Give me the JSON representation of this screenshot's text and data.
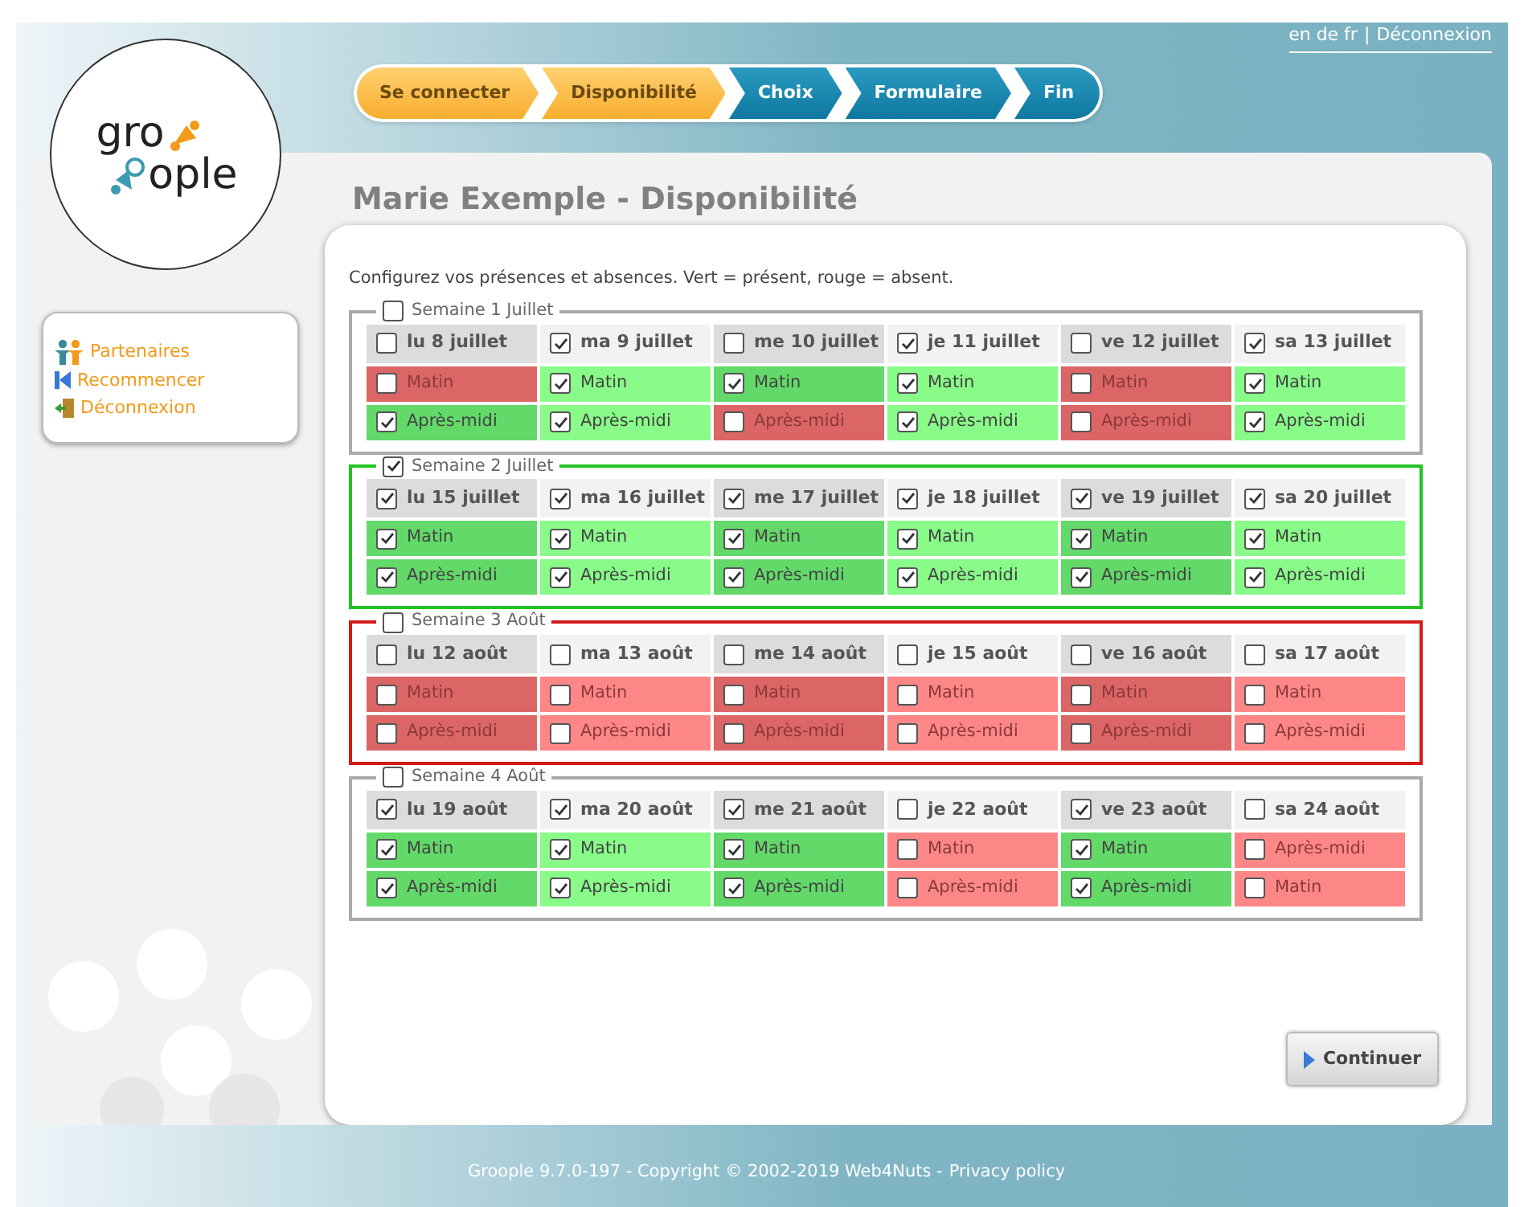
{
  "top_links": {
    "languages": "en de fr",
    "separator": "|",
    "logout": "Déconnexion"
  },
  "logo": {
    "part_1": "gro",
    "part_2": "ople"
  },
  "steps": [
    {
      "label": "Se connecter",
      "done": true
    },
    {
      "label": "Disponibilité",
      "done": true
    },
    {
      "label": "Choix",
      "done": false
    },
    {
      "label": "Formulaire",
      "done": false
    },
    {
      "label": "Fin",
      "done": false
    }
  ],
  "sidebar": {
    "items": [
      {
        "label": "Partenaires",
        "kind": "partners"
      },
      {
        "label": "Recommencer",
        "kind": "restart"
      },
      {
        "label": "Déconnexion",
        "kind": "logout"
      }
    ]
  },
  "title": "Marie Exemple - Disponibilité",
  "intro": "Configurez vos présences et absences. Vert = présent, rouge = absent.",
  "weeks": [
    {
      "label": "Semaine 1 Juillet",
      "checked": false,
      "color": "#aaaaaa",
      "days": [
        {
          "label": "lu 8 juillet",
          "checked": false,
          "slots": [
            {
              "label": "Matin",
              "checked": false
            },
            {
              "label": "Après-midi",
              "checked": true
            }
          ]
        },
        {
          "label": "ma 9 juillet",
          "checked": true,
          "slots": [
            {
              "label": "Matin",
              "checked": true
            },
            {
              "label": "Après-midi",
              "checked": true
            }
          ]
        },
        {
          "label": "me 10 juillet",
          "checked": false,
          "slots": [
            {
              "label": "Matin",
              "checked": true
            },
            {
              "label": "Après-midi",
              "checked": false
            }
          ]
        },
        {
          "label": "je 11 juillet",
          "checked": true,
          "slots": [
            {
              "label": "Matin",
              "checked": true
            },
            {
              "label": "Après-midi",
              "checked": true
            }
          ]
        },
        {
          "label": "ve 12 juillet",
          "checked": false,
          "slots": [
            {
              "label": "Matin",
              "checked": false
            },
            {
              "label": "Après-midi",
              "checked": false
            }
          ]
        },
        {
          "label": "sa 13 juillet",
          "checked": true,
          "slots": [
            {
              "label": "Matin",
              "checked": true
            },
            {
              "label": "Après-midi",
              "checked": true
            }
          ]
        }
      ]
    },
    {
      "label": "Semaine 2 Juillet",
      "checked": true,
      "color": "#22c422",
      "days": [
        {
          "label": "lu 15 juillet",
          "checked": true,
          "slots": [
            {
              "label": "Matin",
              "checked": true
            },
            {
              "label": "Après-midi",
              "checked": true
            }
          ]
        },
        {
          "label": "ma 16 juillet",
          "checked": true,
          "slots": [
            {
              "label": "Matin",
              "checked": true
            },
            {
              "label": "Après-midi",
              "checked": true
            }
          ]
        },
        {
          "label": "me 17 juillet",
          "checked": true,
          "slots": [
            {
              "label": "Matin",
              "checked": true
            },
            {
              "label": "Après-midi",
              "checked": true
            }
          ]
        },
        {
          "label": "je 18 juillet",
          "checked": true,
          "slots": [
            {
              "label": "Matin",
              "checked": true
            },
            {
              "label": "Après-midi",
              "checked": true
            }
          ]
        },
        {
          "label": "ve 19 juillet",
          "checked": true,
          "slots": [
            {
              "label": "Matin",
              "checked": true
            },
            {
              "label": "Après-midi",
              "checked": true
            }
          ]
        },
        {
          "label": "sa 20 juillet",
          "checked": true,
          "slots": [
            {
              "label": "Matin",
              "checked": true
            },
            {
              "label": "Après-midi",
              "checked": true
            }
          ]
        }
      ]
    },
    {
      "label": "Semaine 3 Août",
      "checked": false,
      "color": "#d41818",
      "days": [
        {
          "label": "lu 12 août",
          "checked": false,
          "slots": [
            {
              "label": "Matin",
              "checked": false
            },
            {
              "label": "Après-midi",
              "checked": false
            }
          ]
        },
        {
          "label": "ma 13 août",
          "checked": false,
          "slots": [
            {
              "label": "Matin",
              "checked": false
            },
            {
              "label": "Après-midi",
              "checked": false
            }
          ]
        },
        {
          "label": "me 14 août",
          "checked": false,
          "slots": [
            {
              "label": "Matin",
              "checked": false
            },
            {
              "label": "Après-midi",
              "checked": false
            }
          ]
        },
        {
          "label": "je 15 août",
          "checked": false,
          "slots": [
            {
              "label": "Matin",
              "checked": false
            },
            {
              "label": "Après-midi",
              "checked": false
            }
          ]
        },
        {
          "label": "ve 16 août",
          "checked": false,
          "slots": [
            {
              "label": "Matin",
              "checked": false
            },
            {
              "label": "Après-midi",
              "checked": false
            }
          ]
        },
        {
          "label": "sa 17 août",
          "checked": false,
          "slots": [
            {
              "label": "Matin",
              "checked": false
            },
            {
              "label": "Après-midi",
              "checked": false
            }
          ]
        }
      ]
    },
    {
      "label": "Semaine 4 Août",
      "checked": false,
      "color": "#aaaaaa",
      "days": [
        {
          "label": "lu 19 août",
          "checked": true,
          "slots": [
            {
              "label": "Matin",
              "checked": true
            },
            {
              "label": "Après-midi",
              "checked": true
            }
          ]
        },
        {
          "label": "ma 20 août",
          "checked": true,
          "slots": [
            {
              "label": "Matin",
              "checked": true
            },
            {
              "label": "Après-midi",
              "checked": true
            }
          ]
        },
        {
          "label": "me 21 août",
          "checked": true,
          "slots": [
            {
              "label": "Matin",
              "checked": true
            },
            {
              "label": "Après-midi",
              "checked": true
            }
          ]
        },
        {
          "label": "je 22 août",
          "checked": false,
          "slots": [
            {
              "label": "Matin",
              "checked": false
            },
            {
              "label": "Après-midi",
              "checked": false
            }
          ]
        },
        {
          "label": "ve 23 août",
          "checked": true,
          "slots": [
            {
              "label": "Matin",
              "checked": true
            },
            {
              "label": "Après-midi",
              "checked": true
            }
          ]
        },
        {
          "label": "sa 24 août",
          "checked": false,
          "slots": [
            {
              "label": "Après-midi",
              "checked": false
            },
            {
              "label": "Matin",
              "checked": false
            }
          ]
        }
      ]
    }
  ],
  "continue_button": "Continuer",
  "footer": {
    "text": "Groople 9.7.0-197 - Copyright © 2002-2019 Web4Nuts -",
    "link": "Privacy policy"
  }
}
